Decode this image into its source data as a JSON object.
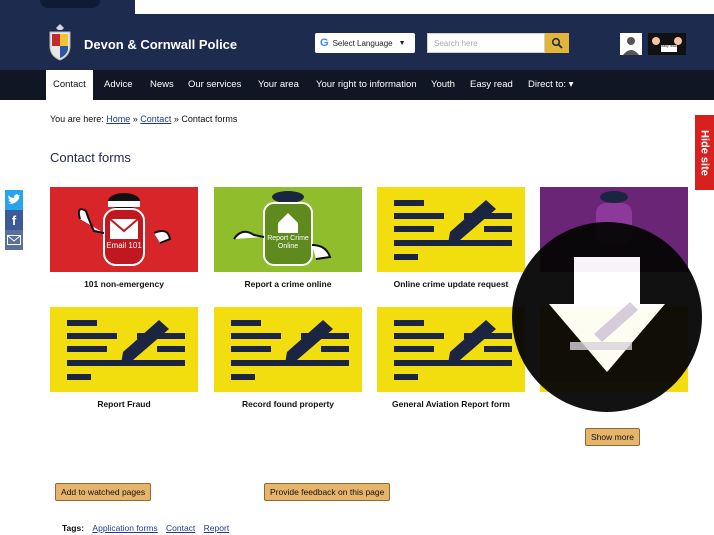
{
  "header": {
    "brand": "Devon & Cornwall Police",
    "language_label": "Select Language",
    "search_placeholder": "Search here",
    "easy_read_label": "easy read"
  },
  "nav": {
    "items": [
      "Contact",
      "Advice",
      "News",
      "Our services",
      "Your area",
      "Your right to information",
      "Youth",
      "Easy read",
      "Direct to: ▾"
    ]
  },
  "breadcrumb": {
    "prefix": "You are here:",
    "home": "Home",
    "sep1": "»",
    "contact": "Contact",
    "sep2": "»",
    "current": "Contact forms"
  },
  "page": {
    "title": "Contact forms",
    "hide_site": "Hide site"
  },
  "cards": [
    {
      "label": "101 non-emergency",
      "img_text": "Email 101"
    },
    {
      "label": "Report a crime online",
      "img_text": "Report Crime Online"
    },
    {
      "label": "Online crime update request"
    },
    {
      "label": "Report Fraud"
    },
    {
      "label": "Record found property"
    },
    {
      "label": "General Aviation Report form"
    }
  ],
  "buttons": {
    "show_more": "Show more",
    "add_watched": "Add to watched pages",
    "feedback": "Provide feedback on this page"
  },
  "tags": {
    "label": "Tags:",
    "items": [
      "Application forms",
      "Contact",
      "Report"
    ]
  },
  "colors": {
    "header_bg": "#1d2b4f",
    "nav_bg": "#101624",
    "card_yellow": "#f2dd0e",
    "card_red": "#d8252a",
    "card_green": "#8fbd2b",
    "card_purple": "#6a2577",
    "hide_site_red": "#d8201f"
  }
}
